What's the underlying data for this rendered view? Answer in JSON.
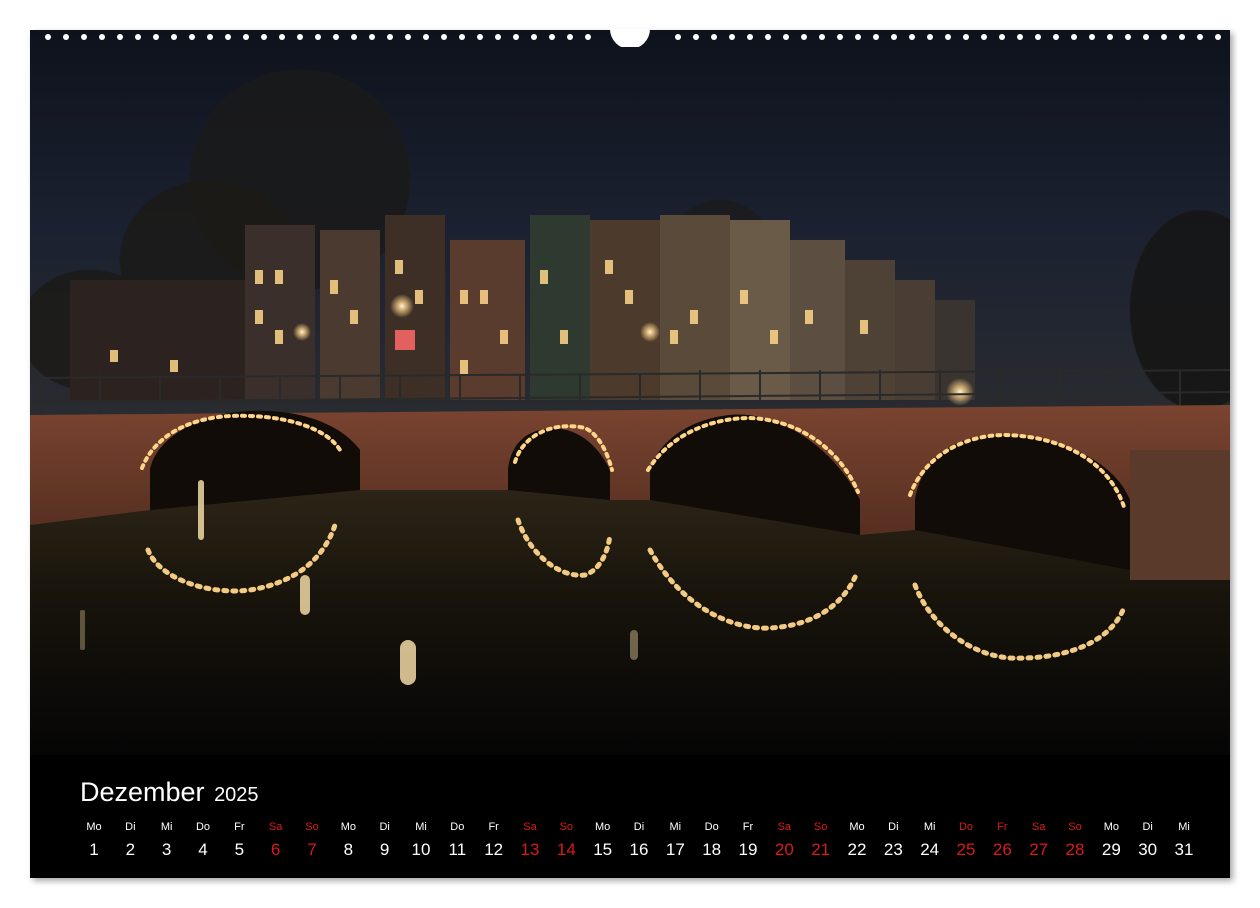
{
  "calendar": {
    "month": "Dezember",
    "year": "2025",
    "days": [
      {
        "wd": "Mo",
        "num": "1",
        "red": false
      },
      {
        "wd": "Di",
        "num": "2",
        "red": false
      },
      {
        "wd": "Mi",
        "num": "3",
        "red": false
      },
      {
        "wd": "Do",
        "num": "4",
        "red": false
      },
      {
        "wd": "Fr",
        "num": "5",
        "red": false
      },
      {
        "wd": "Sa",
        "num": "6",
        "red": true
      },
      {
        "wd": "So",
        "num": "7",
        "red": true
      },
      {
        "wd": "Mo",
        "num": "8",
        "red": false
      },
      {
        "wd": "Di",
        "num": "9",
        "red": false
      },
      {
        "wd": "Mi",
        "num": "10",
        "red": false
      },
      {
        "wd": "Do",
        "num": "11",
        "red": false
      },
      {
        "wd": "Fr",
        "num": "12",
        "red": false
      },
      {
        "wd": "Sa",
        "num": "13",
        "red": true
      },
      {
        "wd": "So",
        "num": "14",
        "red": true
      },
      {
        "wd": "Mo",
        "num": "15",
        "red": false
      },
      {
        "wd": "Di",
        "num": "16",
        "red": false
      },
      {
        "wd": "Mi",
        "num": "17",
        "red": false
      },
      {
        "wd": "Do",
        "num": "18",
        "red": false
      },
      {
        "wd": "Fr",
        "num": "19",
        "red": false
      },
      {
        "wd": "Sa",
        "num": "20",
        "red": true
      },
      {
        "wd": "So",
        "num": "21",
        "red": true
      },
      {
        "wd": "Mo",
        "num": "22",
        "red": false
      },
      {
        "wd": "Di",
        "num": "23",
        "red": false
      },
      {
        "wd": "Mi",
        "num": "24",
        "red": false
      },
      {
        "wd": "Do",
        "num": "25",
        "red": true
      },
      {
        "wd": "Fr",
        "num": "26",
        "red": true
      },
      {
        "wd": "Sa",
        "num": "27",
        "red": true
      },
      {
        "wd": "So",
        "num": "28",
        "red": true
      },
      {
        "wd": "Mo",
        "num": "29",
        "red": false
      },
      {
        "wd": "Di",
        "num": "30",
        "red": false
      },
      {
        "wd": "Mi",
        "num": "31",
        "red": false
      }
    ]
  },
  "colors": {
    "weekend": "#d81b1b",
    "text": "#ffffff",
    "background": "#000000",
    "sky": "#1a1f2e",
    "brick": "#6b3a28",
    "lights": "#ffd58a"
  },
  "photo_subject": "amsterdam-canal-bridge-night-icon"
}
